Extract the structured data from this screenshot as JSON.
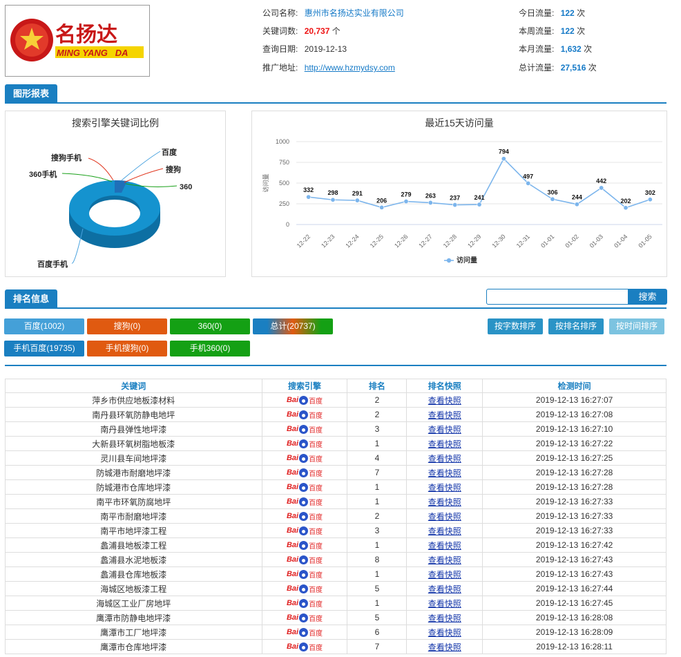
{
  "logo": {
    "cn_text": "名扬达",
    "en_text": "MING YANG   DA"
  },
  "company": {
    "name_label": "公司名称:",
    "name_value": "惠州市名扬达实业有限公司",
    "keywords_label": "关键词数:",
    "keywords_value": "20,737",
    "keywords_unit": "个",
    "date_label": "查询日期:",
    "date_value": "2019-12-13",
    "url_label": "推广地址:",
    "url_value": "http://www.hzmydsy.com"
  },
  "traffic": {
    "today_label": "今日流量:",
    "today_value": "122",
    "week_label": "本周流量:",
    "week_value": "122",
    "month_label": "本月流量:",
    "month_value": "1,632",
    "total_label": "总计流量:",
    "total_value": "27,516",
    "unit": "次"
  },
  "sections": {
    "charts_tab": "图形报表",
    "ranking_tab": "排名信息"
  },
  "search": {
    "placeholder": "",
    "button": "搜索"
  },
  "filters": [
    {
      "label": "百度(1002)",
      "color": "#44a0d8"
    },
    {
      "label": "搜狗(0)",
      "color": "#e05a10"
    },
    {
      "label": "360(0)",
      "color": "#14a014"
    },
    {
      "label": "总计(20737)",
      "color": "gradient"
    },
    {
      "label": "手机百度(19735)",
      "color": "#1a7fc1"
    },
    {
      "label": "手机搜狗(0)",
      "color": "#e05a10"
    },
    {
      "label": "手机360(0)",
      "color": "#14a014"
    }
  ],
  "sort_buttons": [
    {
      "label": "按字数排序",
      "color": "#2a93c6"
    },
    {
      "label": "按排名排序",
      "color": "#2a93c6"
    },
    {
      "label": "按时间排序",
      "color": "#7cc3e0"
    }
  ],
  "colors": {
    "accent": "#1a7fc1",
    "line": "#7cb5ec",
    "donut": "#1593cf",
    "donut_side": "#0d6fa3"
  },
  "chart_data": [
    {
      "type": "pie",
      "title": "搜索引擎关键词比例",
      "labels": [
        "百度",
        "搜狗",
        "360",
        "百度手机",
        "360手机",
        "搜狗手机"
      ],
      "values": [
        1002,
        0,
        0,
        19735,
        0,
        0
      ]
    },
    {
      "type": "line",
      "title": "最近15天访问量",
      "ylabel": "访问量",
      "ylim": [
        0,
        1000
      ],
      "yticks": [
        "0",
        "250",
        "500",
        "750",
        "1000"
      ],
      "categories": [
        "12-22",
        "12-23",
        "12-24",
        "12-25",
        "12-26",
        "12-27",
        "12-28",
        "12-29",
        "12-30",
        "12-31",
        "01-01",
        "01-02",
        "01-03",
        "01-04",
        "01-05"
      ],
      "series": [
        {
          "name": "访问量",
          "values": [
            332,
            298,
            291,
            206,
            279,
            263,
            237,
            241,
            794,
            497,
            306,
            244,
            442,
            202,
            302
          ]
        }
      ],
      "legend": "bottom"
    }
  ],
  "table": {
    "headers": [
      "关键词",
      "搜索引擎",
      "排名",
      "排名快照",
      "检测时间"
    ],
    "engine_bai": "Bai",
    "engine_du": "百度",
    "snapshot_label": "查看快照",
    "rows": [
      {
        "keyword": "萍乡市供应地板漆材料",
        "rank": "2",
        "time": "2019-12-13 16:27:07"
      },
      {
        "keyword": "南丹县环氧防静电地坪",
        "rank": "2",
        "time": "2019-12-13 16:27:08"
      },
      {
        "keyword": "南丹县弹性地坪漆",
        "rank": "3",
        "time": "2019-12-13 16:27:10"
      },
      {
        "keyword": "大新县环氧树脂地板漆",
        "rank": "1",
        "time": "2019-12-13 16:27:22"
      },
      {
        "keyword": "灵川县车间地坪漆",
        "rank": "4",
        "time": "2019-12-13 16:27:25"
      },
      {
        "keyword": "防城港市耐磨地坪漆",
        "rank": "7",
        "time": "2019-12-13 16:27:28"
      },
      {
        "keyword": "防城港市仓库地坪漆",
        "rank": "1",
        "time": "2019-12-13 16:27:28"
      },
      {
        "keyword": "南平市环氧防腐地坪",
        "rank": "1",
        "time": "2019-12-13 16:27:33"
      },
      {
        "keyword": "南平市耐磨地坪漆",
        "rank": "2",
        "time": "2019-12-13 16:27:33"
      },
      {
        "keyword": "南平市地坪漆工程",
        "rank": "3",
        "time": "2019-12-13 16:27:33"
      },
      {
        "keyword": "蠡浦县地板漆工程",
        "rank": "1",
        "time": "2019-12-13 16:27:42"
      },
      {
        "keyword": "蠡浦县水泥地板漆",
        "rank": "8",
        "time": "2019-12-13 16:27:43"
      },
      {
        "keyword": "蠡浦县仓库地板漆",
        "rank": "1",
        "time": "2019-12-13 16:27:43"
      },
      {
        "keyword": "海城区地板漆工程",
        "rank": "5",
        "time": "2019-12-13 16:27:44"
      },
      {
        "keyword": "海城区工业厂房地坪",
        "rank": "1",
        "time": "2019-12-13 16:27:45"
      },
      {
        "keyword": "鹰潭市防静电地坪漆",
        "rank": "5",
        "time": "2019-12-13 16:28:08"
      },
      {
        "keyword": "鹰潭市工厂地坪漆",
        "rank": "6",
        "time": "2019-12-13 16:28:09"
      },
      {
        "keyword": "鹰潭市仓库地坪漆",
        "rank": "7",
        "time": "2019-12-13 16:28:11"
      }
    ]
  }
}
